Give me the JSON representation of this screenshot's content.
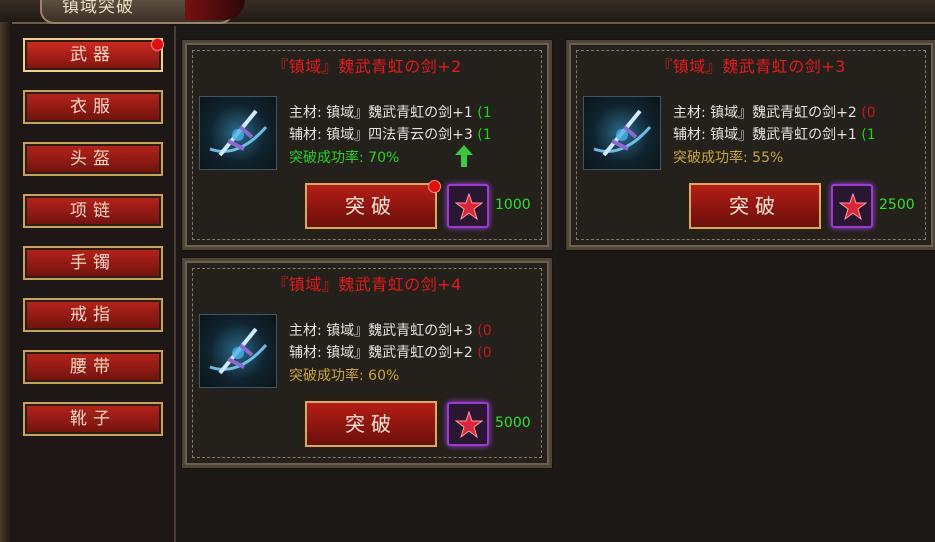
{
  "header": {
    "title": "镇域突破"
  },
  "sidebar": {
    "items": [
      {
        "label": "武器",
        "active": true,
        "notify": true
      },
      {
        "label": "衣服",
        "active": false,
        "notify": false
      },
      {
        "label": "头盔",
        "active": false,
        "notify": false
      },
      {
        "label": "项链",
        "active": false,
        "notify": false
      },
      {
        "label": "手镯",
        "active": false,
        "notify": false
      },
      {
        "label": "戒指",
        "active": false,
        "notify": false
      },
      {
        "label": "腰带",
        "active": false,
        "notify": false
      },
      {
        "label": "靴子",
        "active": false,
        "notify": false
      }
    ]
  },
  "cards": [
    {
      "title": "『镇域』魏武青虹の剑+2",
      "main_material": "主材: 镇域』魏武青虹の剑+1",
      "main_suffix": "(1",
      "sub_material": "辅材: 镇域』四法青云の剑+3",
      "sub_suffix": "(1",
      "success_rate": "突破成功率: 70%",
      "rate_color": "green",
      "show_up_arrow": true,
      "button_label": "突破",
      "button_notify": true,
      "cost": "1000"
    },
    {
      "title": "『镇域』魏武青虹の剑+3",
      "main_material": "主材: 镇域』魏武青虹の剑+2",
      "main_suffix": "(0",
      "sub_material": "辅材: 镇域』魏武青虹の剑+1",
      "sub_suffix": "(1",
      "success_rate": "突破成功率: 55%",
      "rate_color": "gold",
      "show_up_arrow": false,
      "button_label": "突破",
      "button_notify": false,
      "cost": "2500"
    },
    {
      "title": "『镇域』魏武青虹の剑+4",
      "main_material": "主材: 镇域』魏武青虹の剑+3",
      "main_suffix": "(0",
      "sub_material": "辅材: 镇域』魏武青虹の剑+2",
      "sub_suffix": "(0",
      "success_rate": "突破成功率: 60%",
      "rate_color": "gold",
      "show_up_arrow": false,
      "button_label": "突破",
      "button_notify": false,
      "cost": "5000"
    }
  ],
  "colors": {
    "title_red": "#e11a1a",
    "success_green": "#24d424",
    "success_gold": "#c9a53a",
    "cost_green": "#2ee02e",
    "button_red": "#b61d16"
  },
  "icons": {
    "item": "sword-item-icon",
    "gem": "red-star-gem-icon",
    "arrow": "up-arrow-icon"
  }
}
